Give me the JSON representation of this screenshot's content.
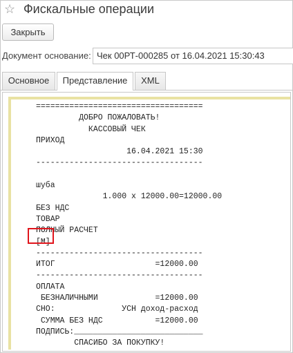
{
  "window": {
    "title": "Фискальные операции",
    "favorite_icon": "star-icon"
  },
  "toolbar": {
    "close_label": "Закрыть"
  },
  "document": {
    "label": "Документ основание:",
    "value": "Чек 00РТ-000285 от 16.04.2021 15:30:43"
  },
  "tabs": [
    {
      "label": "Основное",
      "active": false
    },
    {
      "label": "Представление",
      "active": true
    },
    {
      "label": "XML",
      "active": false
    }
  ],
  "receipt": {
    "lines": [
      "===================================",
      "         ДОБРО ПОЖАЛОВАТЬ!",
      "           КАССОВЫЙ ЧЕК",
      "ПРИХОД",
      "                   16.04.2021 15:30",
      "-----------------------------------",
      "",
      "шуба",
      "              1.000 x 12000.00=12000.00",
      "БЕЗ НДС",
      "ТОВАР",
      "ПОЛНЫЙ РАСЧЕТ",
      "[M]",
      "-----------------------------------",
      "ИТОГ                     =12000.00",
      "-----------------------------------",
      "ОПЛАТА",
      " БЕЗНАЛИЧНЫМИ            =12000.00",
      "СНО:              УСН доход-расход",
      " СУММА БЕЗ НДС           =12000.00",
      "ПОДПИСЬ:___________________________",
      "        СПАСИБО ЗА ПОКУПКУ!",
      "==================================="
    ]
  },
  "highlight": {
    "color": "#e0141b",
    "target_text": "[M]"
  }
}
